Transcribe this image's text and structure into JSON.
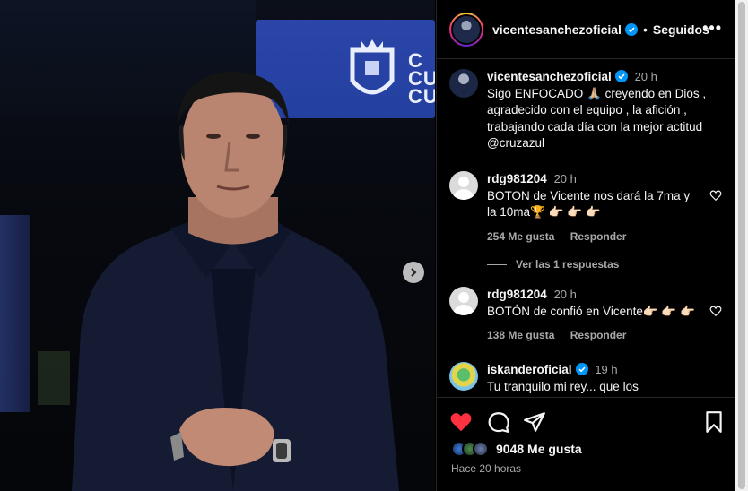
{
  "post": {
    "username": "vicentesanchezoficial",
    "follow_status": "Seguidos",
    "more": "•••",
    "caption": {
      "username": "vicentesanchezoficial",
      "time": "20 h",
      "text": "Sigo ENFOCADO 🙏🏼 creyendo en Dios , agradecido con el equipo , la afición , trabajando cada día con la mejor actitud @cruzazul"
    },
    "comments": [
      {
        "username": "rdg981204",
        "time": "20 h",
        "text": "BOTON de Vicente nos dará la 7ma y la 10ma🏆 👉🏻 👉🏻 👉🏻",
        "likes": "254 Me gusta",
        "reply": "Responder"
      },
      {
        "username": "rdg981204",
        "time": "20 h",
        "text": "BOTÓN de confió en Vicente👉🏻 👉🏻 👉🏻",
        "likes": "138 Me gusta",
        "reply": "Responder"
      },
      {
        "username": "iskanderoficial",
        "time": "19 h",
        "text": "Tu tranquilo mi rey... que los"
      }
    ],
    "view_replies": "Ver las 1 respuestas",
    "likes_count": "9048 Me gusta",
    "posted": "Hace 20 horas"
  },
  "photo": {
    "banner_text": "C\nCU\nCU"
  },
  "colors": {
    "heart_liked": "#ff3040",
    "verified": "#0095f6",
    "muted": "#a8a8a8"
  }
}
